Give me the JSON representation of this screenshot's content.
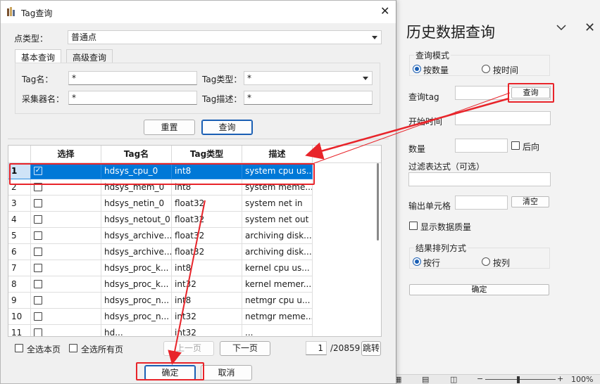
{
  "history": {
    "title": "历史数据查询",
    "query_mode_label": "查询模式",
    "mode_by_count": "按数量",
    "mode_by_time": "按时间",
    "query_tag_label": "查询tag",
    "query_button": "查询",
    "start_time_label": "开始时间",
    "count_label": "数量",
    "backward_label": "后向",
    "filter_label": "过滤表达式（可选）",
    "output_cell_label": "输出单元格",
    "clear_button": "清空",
    "show_quality_label": "显示数据质量",
    "sort_label": "结果排列方式",
    "sort_by_row": "按行",
    "sort_by_col": "按列",
    "confirm_button": "确定",
    "zoom": "100%",
    "zoom_minus": "−",
    "zoom_plus": "+"
  },
  "dialog": {
    "title": "Tag查询",
    "point_type_label": "点类型：",
    "point_type_value": "普通点",
    "tabs": [
      "基本查询",
      "高级查询"
    ],
    "tag_name_label": "Tag名：",
    "tag_name_value": "*",
    "tag_type_label": "Tag类型：",
    "tag_type_value": "*",
    "collector_label": "采集器名：",
    "collector_value": "*",
    "tag_desc_label": "Tag描述：",
    "tag_desc_value": "*",
    "reset_button": "重置",
    "query_button": "查询",
    "columns": [
      "选择",
      "Tag名",
      "Tag类型",
      "描述"
    ],
    "rows": [
      {
        "n": "1",
        "name": "hdsys_cpu_0",
        "type": "int8",
        "desc": "system cpu us..."
      },
      {
        "n": "2",
        "name": "hdsys_mem_0",
        "type": "int8",
        "desc": "system meme..."
      },
      {
        "n": "3",
        "name": "hdsys_netin_0",
        "type": "float32",
        "desc": "system net in"
      },
      {
        "n": "4",
        "name": "hdsys_netout_0",
        "type": "float32",
        "desc": "system net out"
      },
      {
        "n": "5",
        "name": "hdsys_archive...",
        "type": "float32",
        "desc": "archiving disk..."
      },
      {
        "n": "6",
        "name": "hdsys_archive...",
        "type": "float32",
        "desc": "archiving disk..."
      },
      {
        "n": "7",
        "name": "hdsys_proc_k...",
        "type": "int8",
        "desc": "kernel cpu us..."
      },
      {
        "n": "8",
        "name": "hdsys_proc_k...",
        "type": "int32",
        "desc": "kernel memer..."
      },
      {
        "n": "9",
        "name": "hdsys_proc_n...",
        "type": "int8",
        "desc": "netmgr cpu u..."
      },
      {
        "n": "10",
        "name": "hdsys_proc_n...",
        "type": "int32",
        "desc": "netmgr meme..."
      },
      {
        "n": "11",
        "name": "hd...",
        "type": "int32",
        "desc": "..."
      }
    ],
    "select_page": "全选本页",
    "select_all": "全选所有页",
    "prev_page": "上一页",
    "next_page": "下一页",
    "page_value": "1",
    "page_total": "/20859",
    "jump": "跳转",
    "ok": "确定",
    "cancel": "取消"
  },
  "colors": {
    "accent": "#0078d7",
    "annotation": "#e8242a"
  }
}
